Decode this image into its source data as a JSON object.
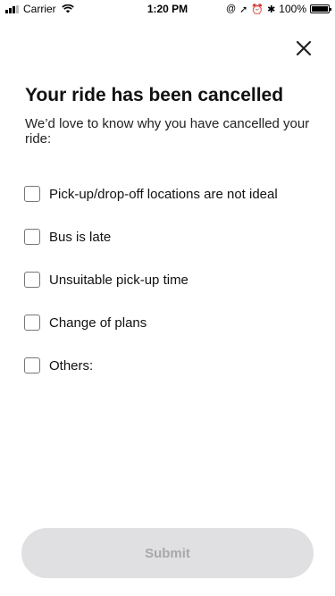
{
  "status_bar": {
    "carrier": "Carrier",
    "time": "1:20 PM",
    "battery": "100%"
  },
  "header": {
    "close_icon": "close-icon"
  },
  "title": "Your ride has been cancelled",
  "subtitle": "We’d love to know why you have cancelled your ride:",
  "reasons": [
    {
      "label": "Pick-up/drop-off locations are not ideal",
      "checked": false
    },
    {
      "label": "Bus is late",
      "checked": false
    },
    {
      "label": "Unsuitable pick-up time",
      "checked": false
    },
    {
      "label": "Change of plans",
      "checked": false
    },
    {
      "label": "Others:",
      "checked": false
    }
  ],
  "submit": {
    "label": "Submit",
    "enabled": false
  },
  "colors": {
    "submit_bg": "#e0e0e2",
    "submit_text": "#a8a8ab",
    "checkbox_border": "#777777"
  }
}
